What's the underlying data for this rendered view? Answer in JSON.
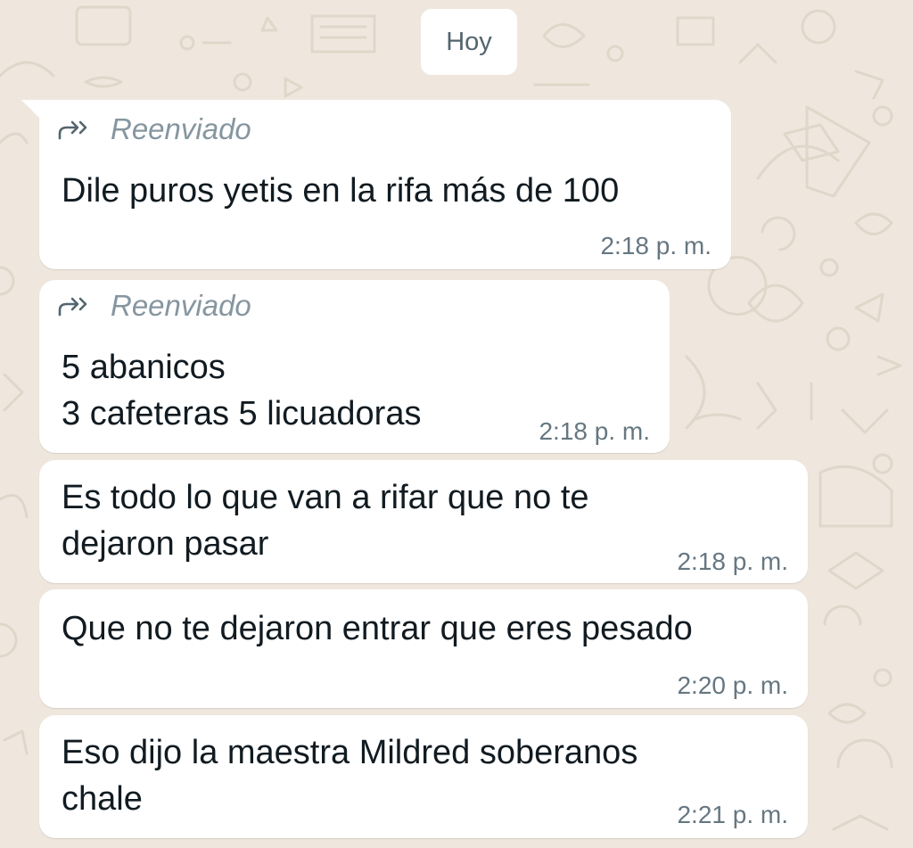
{
  "colors": {
    "wallpaper": "#efe7dd",
    "bubble": "#ffffff",
    "text": "#111b21",
    "meta": "#667781",
    "forwarded": "#8696a0"
  },
  "date_separator": "Hoy",
  "messages": [
    {
      "forwarded": true,
      "forwarded_label": "Reenviado",
      "forwarded_icon": "forward-arrows-icon",
      "text": "Dile puros yetis en la rifa más de 100",
      "time": "2:18 p. m."
    },
    {
      "forwarded": true,
      "forwarded_label": "Reenviado",
      "forwarded_icon": "forward-arrows-icon",
      "text": "5 abanicos\n3 cafeteras 5 licuadoras",
      "time": "2:18 p. m."
    },
    {
      "forwarded": false,
      "text": "Es todo lo que van a rifar que no te\ndejaron pasar",
      "time": "2:18 p. m."
    },
    {
      "forwarded": false,
      "text": "Que no te dejaron entrar que eres pesado",
      "time": "2:20 p. m."
    },
    {
      "forwarded": false,
      "text": "Eso dijo la maestra Mildred soberanos\nchale",
      "time": "2:21 p. m."
    }
  ]
}
